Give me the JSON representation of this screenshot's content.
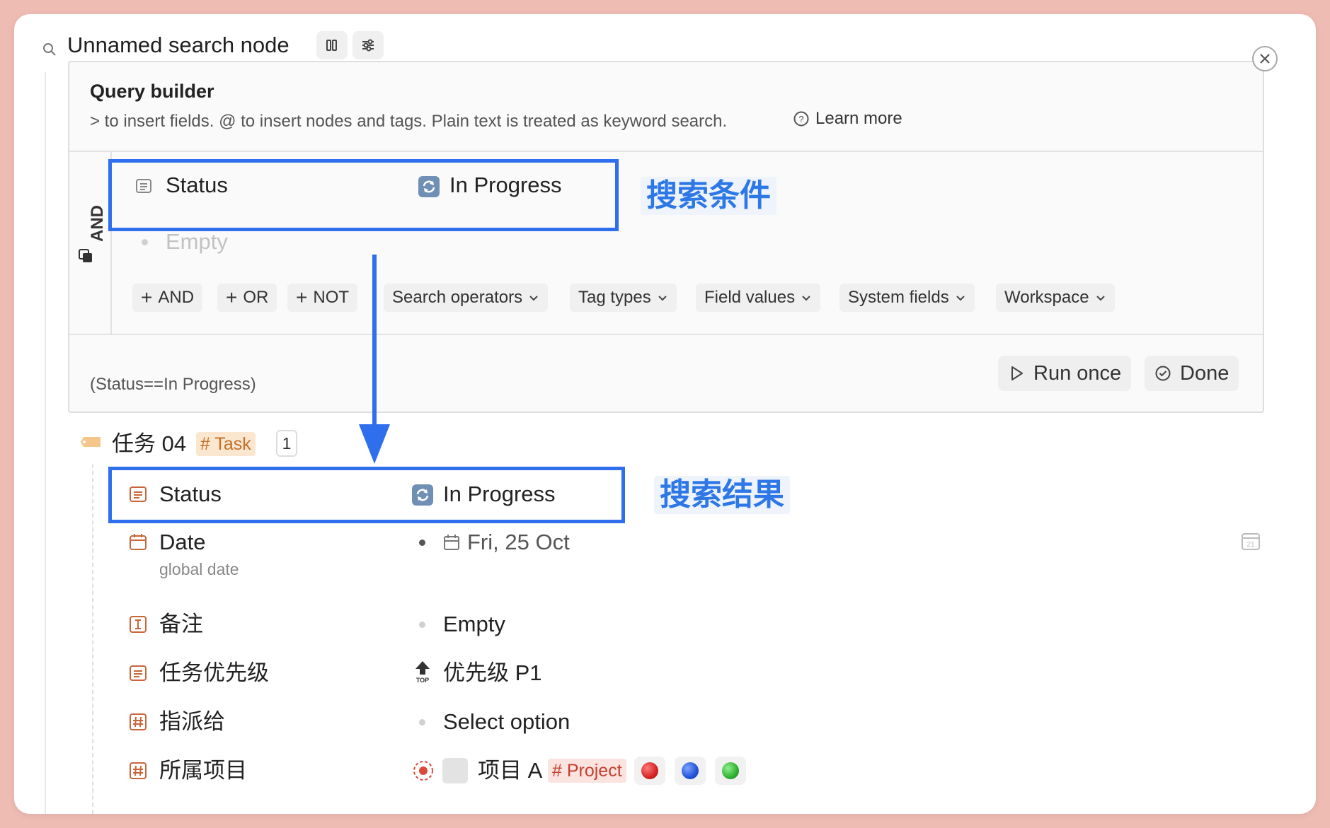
{
  "header": {
    "title": "Unnamed search node"
  },
  "query_builder": {
    "title": "Query builder",
    "hint": "> to insert fields. @ to insert nodes and tags. Plain text is treated as keyword search.",
    "learn_more": "Learn more",
    "operator": "AND",
    "condition": {
      "field": "Status",
      "value": "In Progress"
    },
    "empty_placeholder": "Empty",
    "toolbar": {
      "and": "AND",
      "or": "OR",
      "not": "NOT",
      "search_operators": "Search operators",
      "tag_types": "Tag types",
      "field_values": "Field values",
      "system_fields": "System fields",
      "workspace": "Workspace"
    },
    "expression": "(Status==In Progress)",
    "run_once": "Run once",
    "done": "Done"
  },
  "annotations": {
    "condition_label": "搜索条件",
    "result_label": "搜索结果"
  },
  "result": {
    "node_title": "任务 04",
    "tag": "# Task",
    "count": "1",
    "fields": {
      "status_label": "Status",
      "status_value": "In Progress",
      "date_label": "Date",
      "date_sub": "global date",
      "date_value": "Fri, 25 Oct",
      "note_label": "备注",
      "note_value": "Empty",
      "priority_label": "任务优先级",
      "priority_value": "优先级 P1",
      "assign_label": "指派给",
      "assign_value": "Select option",
      "project_label": "所属项目",
      "project_value": "项目 A",
      "project_tag": "# Project"
    }
  },
  "colors": {
    "accent_blue": "#2f6fee",
    "callout_blue": "#2d78e6",
    "field_icon_orange": "#c8663a",
    "task_tag_bg": "#fbe6cf",
    "task_tag_text": "#c2702a",
    "project_tag_bg": "#fbe3e0",
    "project_tag_text": "#c4402f",
    "ball_red": "#d42424",
    "ball_blue": "#2255d6",
    "ball_green": "#2fb02f"
  }
}
